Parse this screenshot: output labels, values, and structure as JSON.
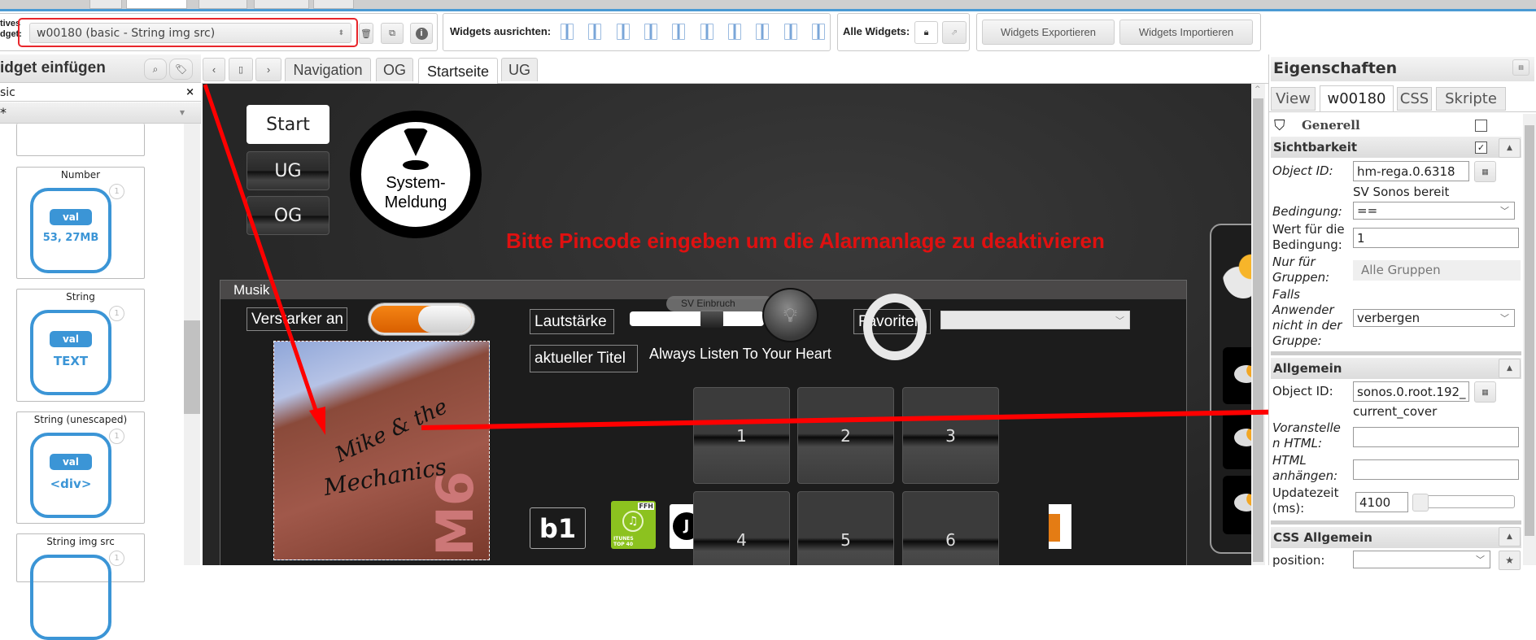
{
  "toolbar": {
    "active_widget_label": "tives\ndget:",
    "active_widget_value": "w00180 (basic - String img src)",
    "align_label": "Widgets ausrichten:",
    "all_widgets_label": "Alle Widgets:",
    "export_label": "Widgets Exportieren",
    "import_label": "Widgets Importieren",
    "highlight_color": "#e8262b"
  },
  "left_panel": {
    "title": "idget einfügen",
    "filter_value": "sic",
    "category_value": "*",
    "cards": [
      {
        "title": "Number",
        "pill": "val",
        "sub": "53, 27MB",
        "badge": "1"
      },
      {
        "title": "String",
        "pill": "val",
        "sub": "TEXT",
        "badge": "1"
      },
      {
        "title": "String (unescaped)",
        "pill": "val",
        "sub": "<div>",
        "badge": "1"
      },
      {
        "title": "String img src",
        "badge": "1"
      }
    ]
  },
  "view_tabs": [
    "Navigation",
    "OG",
    "Startseite",
    "UG"
  ],
  "active_view_tab": "Startseite",
  "canvas": {
    "nav_buttons": [
      "Start",
      "UG",
      "OG"
    ],
    "system_message": [
      "System-",
      "Meldung"
    ],
    "alert_text": "Bitte Pincode eingeben um die Alarmanlage zu deaktivieren",
    "alert_color": "#e01010",
    "music": {
      "title": "Musik",
      "amp_label": "Verstarker an",
      "amp_on": true,
      "volume_label": "Lautstärke",
      "sv_einbruch": "SV Einbruch",
      "favorites_label": "Favoriten",
      "current_title_label": "aktueller Titel",
      "current_title": "Always Listen To Your Heart",
      "cover_text": [
        "Mike & the",
        "Mechanics",
        "M6"
      ],
      "keypad": [
        "1",
        "2",
        "3",
        "4",
        "5",
        "6"
      ],
      "logos": [
        "b1",
        "FFH iTunes Top 40",
        "J"
      ],
      "itunes_text": "ITUNES TOP 40",
      "ffh": "FFH"
    }
  },
  "properties": {
    "title": "Eigenschaften",
    "tabs": [
      "View",
      "w00180",
      "CSS",
      "Skripte"
    ],
    "active_tab": "w00180",
    "generell": "Generell",
    "sichtbarkeit": {
      "title": "Sichtbarkeit",
      "checked": true,
      "object_id_label": "Object ID:",
      "object_id": "hm-rega.0.6318",
      "object_name": "SV Sonos bereit",
      "condition_label": "Bedingung:",
      "condition": "==",
      "value_label": "Wert für die Bedingung:",
      "value": "1",
      "groups_label": "Nur für Gruppen:",
      "groups": "Alle Gruppen",
      "not_in_group_label": "Falls Anwender nicht in der Gruppe:",
      "not_in_group": "verbergen"
    },
    "allgemein": {
      "title": "Allgemein",
      "object_id_label": "Object ID:",
      "object_id": "sonos.0.root.192_",
      "object_name": "current_cover",
      "prepend_label": "Voranstelle n HTML:",
      "prepend": "",
      "append_label": "HTML anhängen:",
      "append": "",
      "update_label": "Updatezeit (ms):",
      "update": "4100"
    },
    "css_allgemein": {
      "title": "CSS Allgemein",
      "position_label": "position:",
      "position": ""
    }
  }
}
